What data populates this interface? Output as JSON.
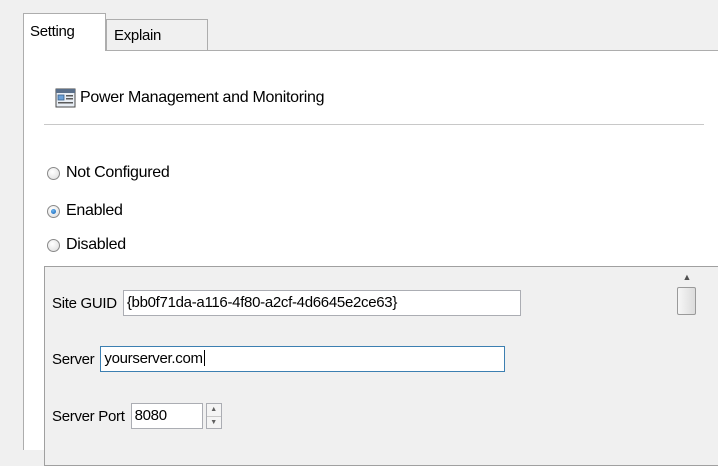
{
  "tabs": [
    {
      "label": "Setting",
      "active": true
    },
    {
      "label": "Explain",
      "active": false
    }
  ],
  "policy": {
    "title": "Power Management and Monitoring",
    "icon": "policy-settings-icon"
  },
  "state_options": [
    {
      "label": "Not Configured",
      "checked": false
    },
    {
      "label": "Enabled",
      "checked": true
    },
    {
      "label": "Disabled",
      "checked": false
    }
  ],
  "options": {
    "site_guid": {
      "label": "Site GUID",
      "value": "{bb0f71da-a116-4f80-a2cf-4d6645e2ce63}"
    },
    "server": {
      "label": "Server",
      "value": "yourserver.com"
    },
    "server_port": {
      "label": "Server Port",
      "value": "8080"
    }
  },
  "colors": {
    "window_bg": "#f0f0f0",
    "panel_bg": "#ffffff",
    "focus_border": "#3c7fb1",
    "radio_dot": "#1f6fc0"
  }
}
